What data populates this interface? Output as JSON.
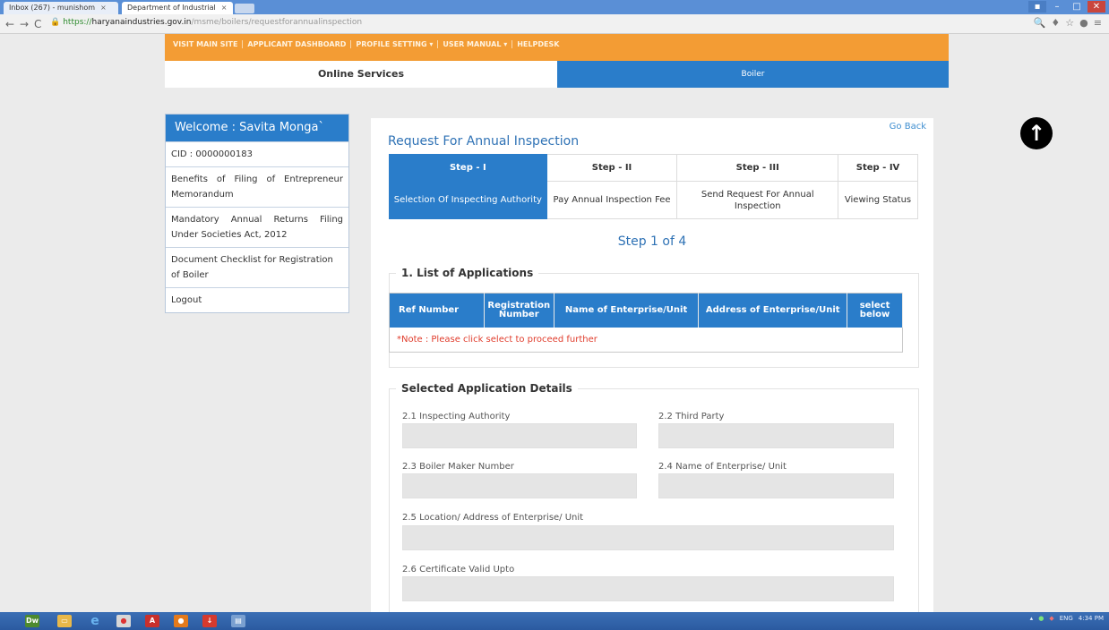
{
  "browser": {
    "tabs": [
      {
        "title": "Inbox (267) - munishom",
        "close": "×"
      },
      {
        "title": "Department of Industrial",
        "close": "×"
      }
    ],
    "url_scheme": "https://",
    "url_host": "haryanaindustries.gov.in",
    "url_path": "/msme/boilers/requestforannualinspection",
    "icons": [
      "back-icon",
      "forward-icon",
      "reload-icon",
      "lock-icon",
      "zoom-icon",
      "star-icon",
      "menu-icon"
    ]
  },
  "topnav": {
    "items": [
      "VISIT MAIN SITE",
      "APPLICANT DASHBOARD",
      "PROFILE SETTING ▾",
      "USER MANUAL ▾",
      "HELPDESK"
    ]
  },
  "services": {
    "online": "Online Services",
    "boiler": "Boiler"
  },
  "sidebar": {
    "welcome": "Welcome : Savita Monga`",
    "cid": "CID : 0000000183",
    "items": [
      "Benefits of Filing of Entrepreneur Memorandum",
      "Mandatory Annual Returns Filing Under Societies Act, 2012",
      "Document Checklist for Registration of Boiler",
      "Logout"
    ]
  },
  "main": {
    "go_back": "Go Back",
    "title": "Request For Annual Inspection",
    "steps": [
      {
        "label": "Step - I",
        "desc": "Selection Of Inspecting Authority"
      },
      {
        "label": "Step - II",
        "desc": "Pay Annual Inspection Fee"
      },
      {
        "label": "Step - III",
        "desc": "Send Request For Annual Inspection"
      },
      {
        "label": "Step - IV",
        "desc": "Viewing Status"
      }
    ],
    "step_of": "Step 1 of 4",
    "list_legend": "1. List of Applications",
    "table_headers": [
      "Ref Number",
      "Registration Number",
      "Name of Enterprise/Unit",
      "Address of Enterprise/Unit",
      "select below"
    ],
    "note": "*Note : Please click select to proceed further",
    "details_legend": "Selected Application Details",
    "fields": {
      "inspecting_authority": "2.1 Inspecting Authority",
      "third_party": "2.2 Third Party",
      "boiler_maker": "2.3 Boiler Maker Number",
      "enterprise_name": "2.4 Name of Enterprise/ Unit",
      "location": "2.5 Location/ Address of Enterprise/ Unit",
      "certificate_valid": "2.6 Certificate Valid Upto"
    }
  },
  "taskbar": {
    "apps": [
      "Dw",
      "file-explorer-icon",
      "ie-icon",
      "chrome-icon",
      "acrobat-icon",
      "firefox-icon",
      "downloader-icon",
      "notepad-icon"
    ],
    "tray_lang": "ENG",
    "tray_time": "4:34 PM"
  },
  "colors": {
    "accent_blue": "#2a7dca",
    "nav_orange": "#f39c34",
    "note_red": "#e03c2c"
  }
}
